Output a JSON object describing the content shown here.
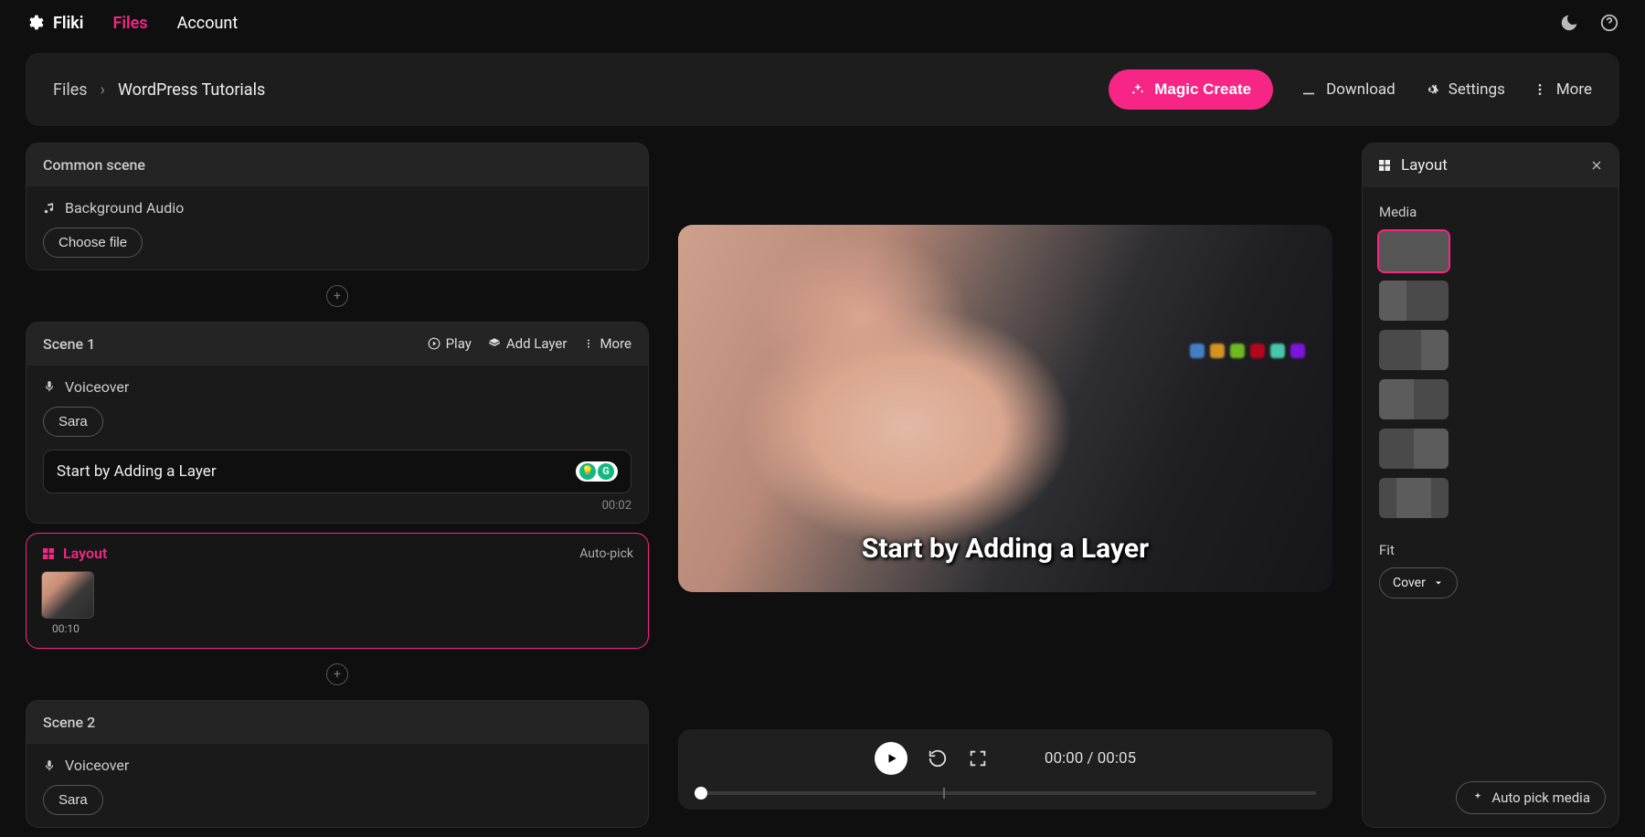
{
  "brand": "Fliki",
  "nav": {
    "files": "Files",
    "account": "Account"
  },
  "breadcrumb": {
    "root": "Files",
    "current": "WordPress Tutorials"
  },
  "toolbar": {
    "magic_create": "Magic Create",
    "download": "Download",
    "settings": "Settings",
    "more": "More"
  },
  "common_scene": {
    "title": "Common scene",
    "bg_audio_label": "Background Audio",
    "choose_file": "Choose file"
  },
  "scene1": {
    "title": "Scene 1",
    "play": "Play",
    "add_layer": "Add Layer",
    "more": "More",
    "voiceover_label": "Voiceover",
    "voice_name": "Sara",
    "script_text": "Start by Adding a Layer",
    "script_duration": "00:02",
    "layout_label": "Layout",
    "auto_pick": "Auto-pick",
    "clip_duration": "00:10"
  },
  "scene2": {
    "title": "Scene 2",
    "voiceover_label": "Voiceover",
    "voice_name": "Sara"
  },
  "preview": {
    "caption": "Start by Adding a Layer"
  },
  "player": {
    "current": "00:00",
    "total": "00:05"
  },
  "layout_panel": {
    "title": "Layout",
    "media_label": "Media",
    "fit_label": "Fit",
    "fit_value": "Cover",
    "auto_pick_media": "Auto pick media"
  }
}
